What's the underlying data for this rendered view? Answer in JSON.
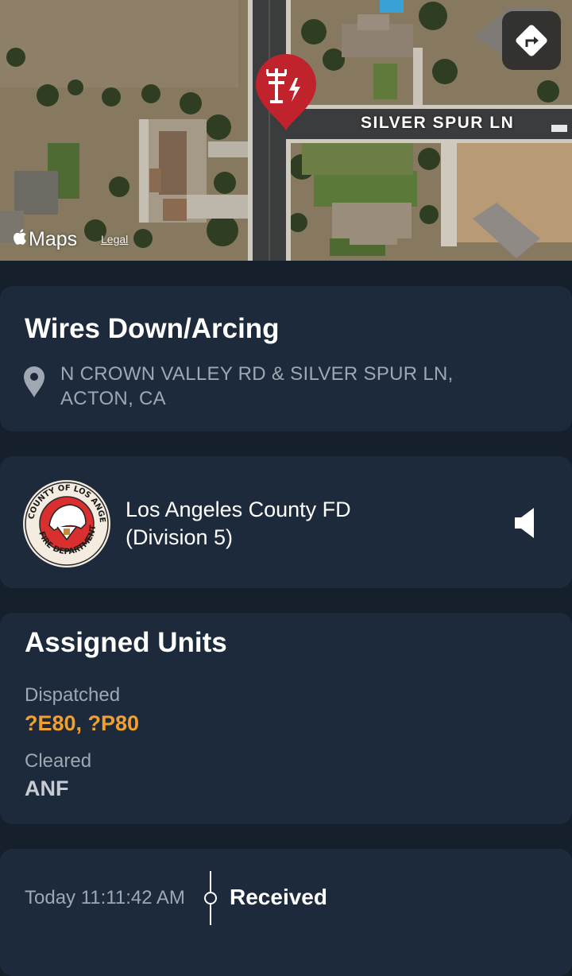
{
  "map": {
    "road_label": "SILVER SPUR LN",
    "logo": "Maps",
    "legal": "Legal",
    "pin_icon": "power-line-icon",
    "pin_color": "#c0232b",
    "directions_icon": "directions-icon"
  },
  "incident": {
    "title": "Wires Down/Arcing",
    "address_line1": "N CROWN VALLEY RD & SILVER SPUR LN,",
    "address_line2": "ACTON, CA",
    "location_icon": "location-pin-icon"
  },
  "agency": {
    "name_line1": "Los Angeles County FD",
    "name_line2": "(Division 5)",
    "seal_icon": "la-county-fire-seal",
    "audio_icon": "speaker-icon"
  },
  "units": {
    "title": "Assigned Units",
    "dispatched_label": "Dispatched",
    "dispatched_value": "?E80, ?P80",
    "cleared_label": "Cleared",
    "cleared_value": "ANF"
  },
  "timeline": {
    "time": "Today 11:11:42 AM",
    "status": "Received"
  },
  "colors": {
    "background": "#15202c",
    "card": "#1d2a3b",
    "accent_orange": "#f0a030",
    "muted_text": "#9ea7b2"
  }
}
